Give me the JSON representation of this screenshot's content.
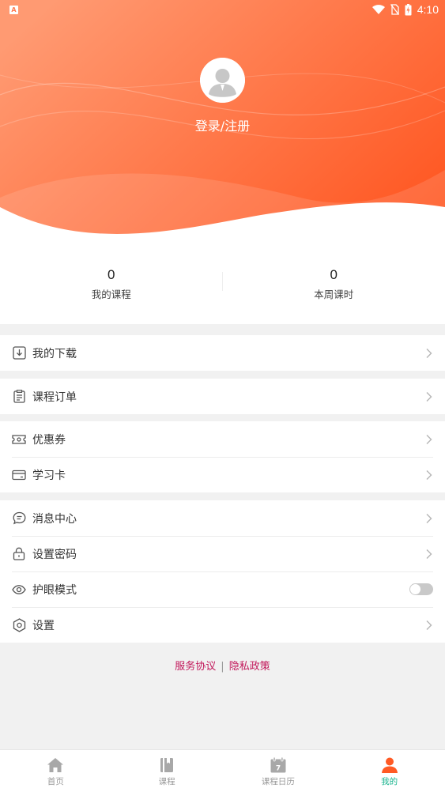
{
  "status_bar": {
    "time": "4:10",
    "app_indicator": "A"
  },
  "profile": {
    "login_text": "登录/注册"
  },
  "stats": [
    {
      "value": "0",
      "label": "我的课程"
    },
    {
      "value": "0",
      "label": "本周课时"
    }
  ],
  "menu": {
    "downloads": "我的下载",
    "orders": "课程订单",
    "coupons": "优惠券",
    "study_card": "学习卡",
    "messages": "消息中心",
    "set_password": "设置密码",
    "eye_mode": "护眼模式",
    "eye_mode_enabled": false,
    "settings": "设置"
  },
  "links": {
    "service": "服务协议",
    "separator": "|",
    "privacy": "隐私政策"
  },
  "tabs": [
    {
      "label": "首页",
      "icon": "home-icon",
      "active": false
    },
    {
      "label": "课程",
      "icon": "book-icon",
      "active": false
    },
    {
      "label": "课程日历",
      "icon": "calendar-icon",
      "day": "7",
      "active": false
    },
    {
      "label": "我的",
      "icon": "person-icon",
      "active": true
    }
  ],
  "colors": {
    "header_gradient_start": "#ff9a72",
    "header_gradient_end": "#ff5a24",
    "active_tab_text": "#18b38d",
    "link": "#c2185b"
  }
}
